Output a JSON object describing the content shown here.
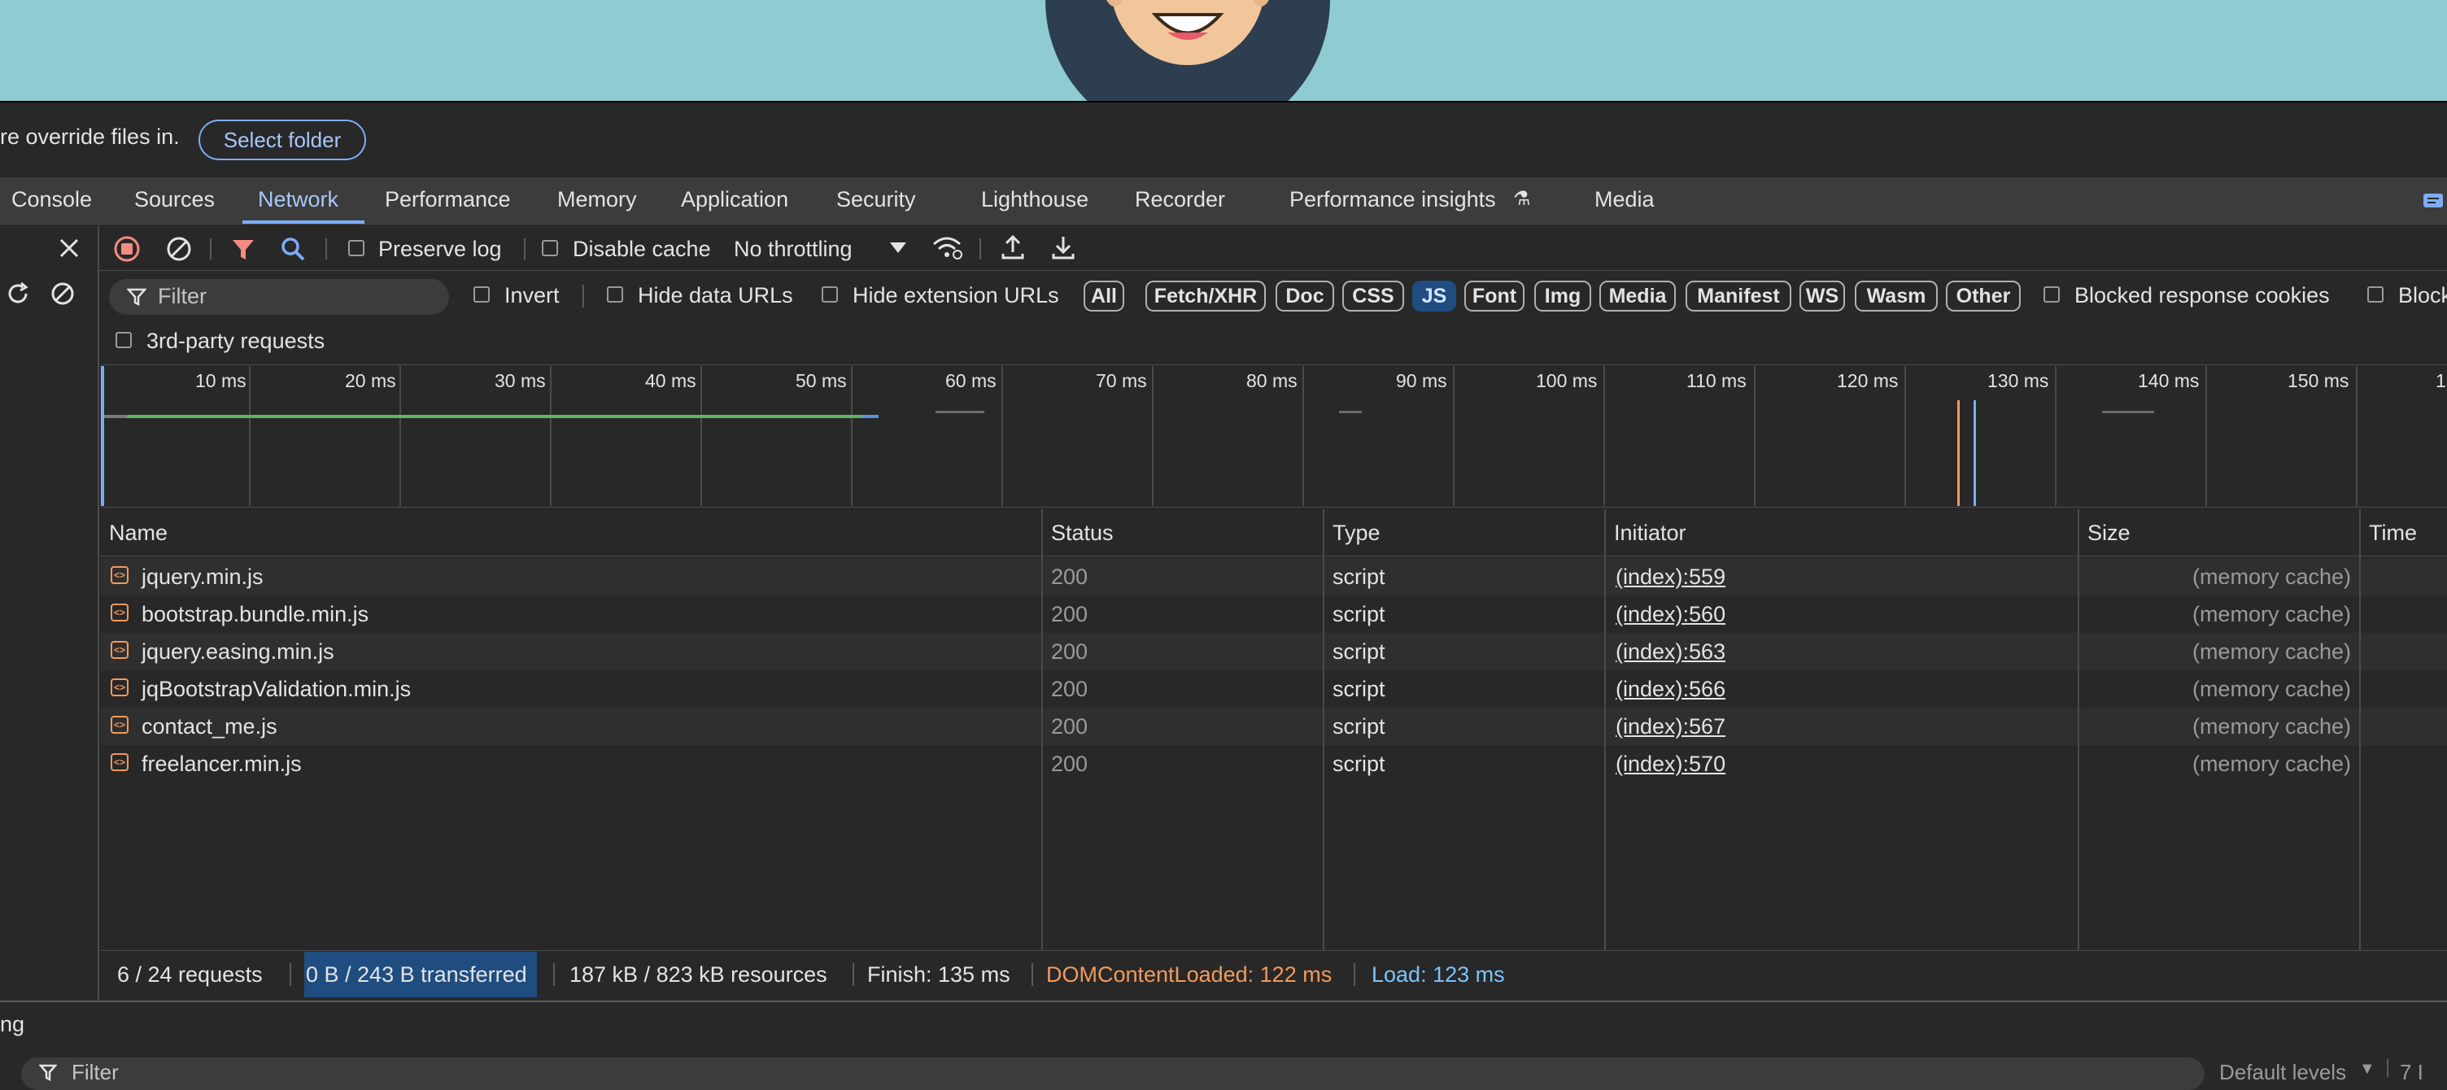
{
  "override_bar": {
    "text": "re override files in.",
    "select_folder": "Select folder"
  },
  "tabs": [
    "Console",
    "Sources",
    "Network",
    "Performance",
    "Memory",
    "Application",
    "Security",
    "Lighthouse",
    "Recorder",
    "Performance insights",
    "Media"
  ],
  "active_tab": "Network",
  "toolbar": {
    "preserve_log": "Preserve log",
    "disable_cache": "Disable cache",
    "throttling": "No throttling"
  },
  "filter": {
    "placeholder": "Filter",
    "invert": "Invert",
    "hide_data_urls": "Hide data URLs",
    "hide_extension_urls": "Hide extension URLs",
    "types": [
      "All",
      "Fetch/XHR",
      "Doc",
      "CSS",
      "JS",
      "Font",
      "Img",
      "Media",
      "Manifest",
      "WS",
      "Wasm",
      "Other"
    ],
    "active_type": "JS",
    "blocked_response_cookies": "Blocked response cookies",
    "blocked_partial": "Block",
    "third_party": "3rd-party requests"
  },
  "timeline": {
    "labels": [
      "10 ms",
      "20 ms",
      "30 ms",
      "40 ms",
      "50 ms",
      "60 ms",
      "70 ms",
      "80 ms",
      "90 ms",
      "100 ms",
      "110 ms",
      "120 ms",
      "130 ms",
      "140 ms",
      "150 ms",
      "1"
    ],
    "dom_content_loaded_ms": 122,
    "load_ms": 123,
    "colors": {
      "domcontentloaded": "#f29a5c",
      "load": "#7cacf8",
      "bar": "#5cb85c"
    }
  },
  "table": {
    "headers": [
      "Name",
      "Status",
      "Type",
      "Initiator",
      "Size",
      "Time"
    ],
    "rows": [
      {
        "name": "jquery.min.js",
        "status": "200",
        "type": "script",
        "initiator": "(index):559",
        "size": "(memory cache)"
      },
      {
        "name": "bootstrap.bundle.min.js",
        "status": "200",
        "type": "script",
        "initiator": "(index):560",
        "size": "(memory cache)"
      },
      {
        "name": "jquery.easing.min.js",
        "status": "200",
        "type": "script",
        "initiator": "(index):563",
        "size": "(memory cache)"
      },
      {
        "name": "jqBootstrapValidation.min.js",
        "status": "200",
        "type": "script",
        "initiator": "(index):566",
        "size": "(memory cache)"
      },
      {
        "name": "contact_me.js",
        "status": "200",
        "type": "script",
        "initiator": "(index):567",
        "size": "(memory cache)"
      },
      {
        "name": "freelancer.min.js",
        "status": "200",
        "type": "script",
        "initiator": "(index):570",
        "size": "(memory cache)"
      }
    ]
  },
  "status_bar": {
    "requests": "6 / 24 requests",
    "transferred": "0 B / 243 B transferred",
    "resources": "187 kB / 823 kB resources",
    "finish": "Finish: 135 ms",
    "dom_content_loaded": "DOMContentLoaded: 122 ms",
    "load": "Load: 123 ms"
  },
  "drawer": {
    "title_partial": "ng",
    "filter_placeholder": "Filter",
    "default_levels": "Default levels",
    "right_partial": "7 I"
  }
}
